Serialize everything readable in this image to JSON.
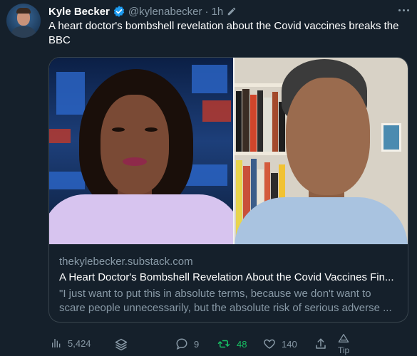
{
  "tweet": {
    "author": "Kyle Becker",
    "handle": "@kylenabecker",
    "time": "1h",
    "separator": "·",
    "text": "A heart doctor's bombshell revelation about the Covid vaccines breaks the BBC"
  },
  "card": {
    "domain": "thekylebecker.substack.com",
    "title": "A Heart Doctor's Bombshell Revelation About the Covid Vaccines Fin...",
    "description": "\"I just want to put this in absolute terms, because we don't want to scare people unnecessarily, but the absolute risk of serious adverse ..."
  },
  "actions": {
    "views": "5,424",
    "replies": "9",
    "retweets": "48",
    "likes": "140",
    "tip_label": "Tip"
  },
  "icons": {
    "verified": "verified-badge-icon",
    "edit": "edit-pencil-icon",
    "more": "more-options-icon",
    "analytics": "analytics-icon",
    "layers": "layers-icon",
    "reply": "reply-icon",
    "retweet": "retweet-icon",
    "like": "heart-icon",
    "share": "share-icon",
    "tip": "tip-icon"
  },
  "colors": {
    "background": "#15202b",
    "secondary_text": "#8899a6",
    "accent": "#1d9bf0",
    "retweet": "#17bf63",
    "border": "#38444d"
  }
}
